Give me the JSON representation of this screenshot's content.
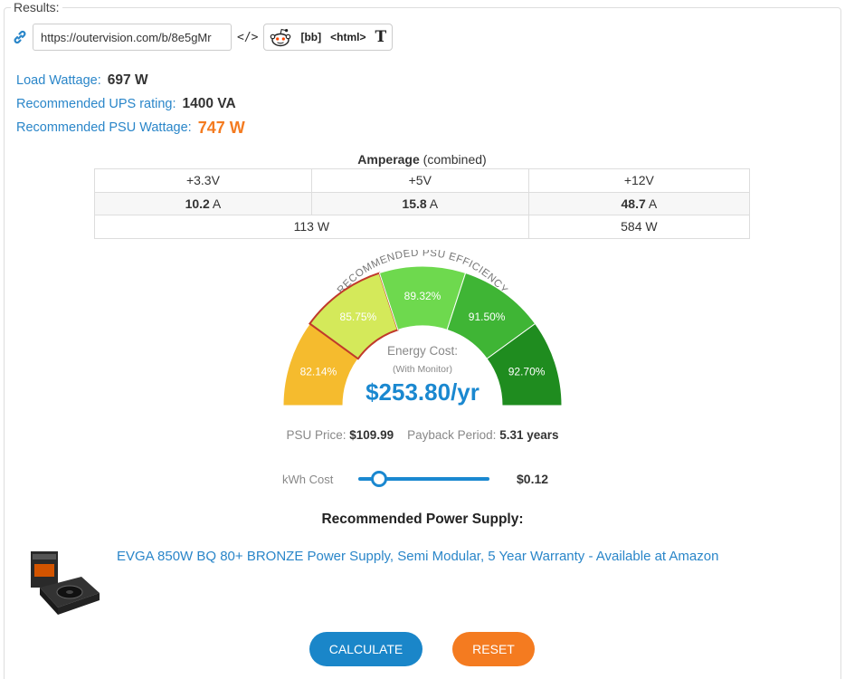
{
  "legend": "Results:",
  "share": {
    "url": "https://outervision.com/b/8e5gMr",
    "embed_label": "</>",
    "bb_label": "[bb]",
    "html_label": "<html>",
    "text_label": "T"
  },
  "summary": {
    "load_label": "Load Wattage:",
    "load_value": "697 W",
    "ups_label": "Recommended UPS rating:",
    "ups_value": "1400 VA",
    "psu_label": "Recommended PSU Wattage:",
    "psu_value": "747 W"
  },
  "amperage": {
    "title_bold": "Amperage",
    "title_rest": " (combined)",
    "headers": [
      "+3.3V",
      "+5V",
      "+12V"
    ],
    "amps": [
      "10.2",
      "15.8",
      "48.7"
    ],
    "amp_unit": " A",
    "combined_low": "113 W",
    "combined_12v": "584 W"
  },
  "efficiency": {
    "arc_title": "RECOMMENDED PSU EFFICIENCY",
    "segments": [
      {
        "label": "82.14%",
        "color": "#f5bb2e"
      },
      {
        "label": "85.75%",
        "color": "#d4e95a"
      },
      {
        "label": "89.32%",
        "color": "#6ed94e"
      },
      {
        "label": "91.50%",
        "color": "#3fb535"
      },
      {
        "label": "92.70%",
        "color": "#1f8c1f"
      }
    ],
    "selected_index": 1
  },
  "energy": {
    "label": "Energy Cost:",
    "sub": "(With Monitor)",
    "value": "$253.80/yr"
  },
  "price": {
    "psu_price_label": "PSU Price:",
    "psu_price": "$109.99",
    "payback_label": "Payback Period:",
    "payback": "5.31 years"
  },
  "kwh": {
    "label": "kWh Cost",
    "value": "$0.12",
    "slider_fraction": 0.16
  },
  "recommendation": {
    "title": "Recommended Power Supply:",
    "link": "EVGA 850W BQ 80+ BRONZE Power Supply, Semi Modular, 5 Year Warranty - Available at Amazon"
  },
  "buttons": {
    "calculate": "CALCULATE",
    "reset": "RESET"
  },
  "colors": {
    "accent_blue": "#1a86c9",
    "accent_orange": "#f47b20"
  }
}
